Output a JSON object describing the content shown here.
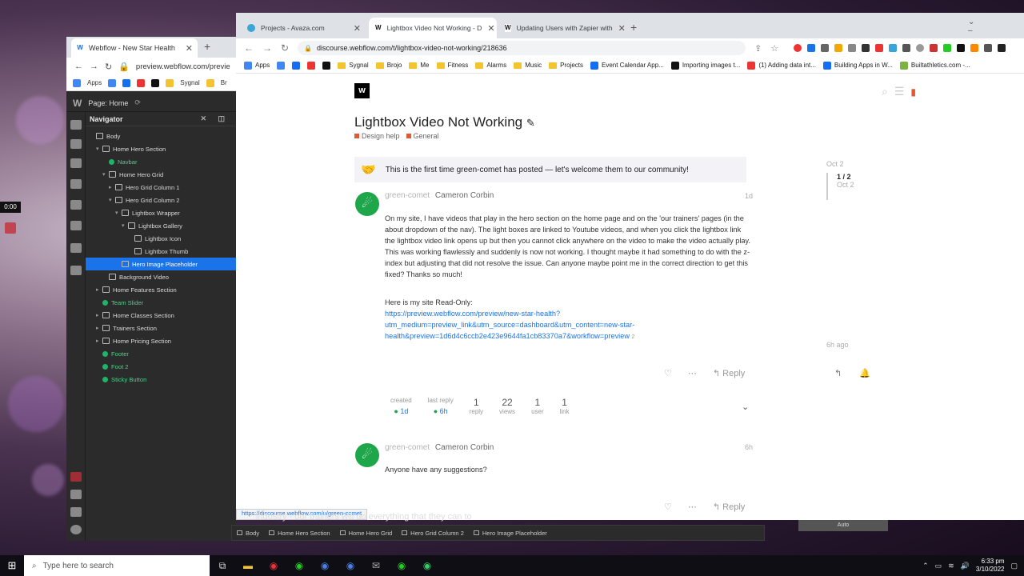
{
  "colors": {
    "webflow_blue": "#146ef5",
    "selection": "#1a73e8",
    "symbol_green": "#48d18a",
    "category_red": "#e45735"
  },
  "video": {
    "time": "0:00"
  },
  "webflow_window": {
    "tab_title": "Webflow - New Star Health",
    "url": "preview.webflow.com/previe",
    "bookmarks": [
      "Apps",
      "Sygnal",
      "Br"
    ],
    "page_label": "Page: Home",
    "navigator_title": "Navigator",
    "tree": [
      {
        "label": "Body",
        "indent": 0,
        "caret": "",
        "kind": "box"
      },
      {
        "label": "Home Hero Section",
        "indent": 1,
        "caret": "▾",
        "kind": "box"
      },
      {
        "label": "Navbar",
        "indent": 2,
        "caret": "",
        "kind": "symbol"
      },
      {
        "label": "Home Hero Grid",
        "indent": 2,
        "caret": "▾",
        "kind": "grid"
      },
      {
        "label": "Hero Grid Column 1",
        "indent": 3,
        "caret": "▸",
        "kind": "box"
      },
      {
        "label": "Hero Grid Column 2",
        "indent": 3,
        "caret": "▾",
        "kind": "box"
      },
      {
        "label": "Lightbox Wrapper",
        "indent": 4,
        "caret": "▾",
        "kind": "box"
      },
      {
        "label": "Lightbox Gallery",
        "indent": 5,
        "caret": "▾",
        "kind": "box"
      },
      {
        "label": "Lightbox Icon",
        "indent": 6,
        "caret": "",
        "kind": "img"
      },
      {
        "label": "Lightbox Thumb",
        "indent": 6,
        "caret": "",
        "kind": "img"
      },
      {
        "label": "Hero Image Placeholder",
        "indent": 4,
        "caret": "",
        "kind": "img",
        "selected": true
      },
      {
        "label": "Background Video",
        "indent": 2,
        "caret": "",
        "kind": "box"
      },
      {
        "label": "Home Features Section",
        "indent": 1,
        "caret": "▸",
        "kind": "box"
      },
      {
        "label": "Team Slider",
        "indent": 1,
        "caret": "",
        "kind": "symbol"
      },
      {
        "label": "Home Classes Section",
        "indent": 1,
        "caret": "▸",
        "kind": "box"
      },
      {
        "label": "Trainers Section",
        "indent": 1,
        "caret": "▸",
        "kind": "box"
      },
      {
        "label": "Home Pricing Section",
        "indent": 1,
        "caret": "▸",
        "kind": "box"
      },
      {
        "label": "Footer",
        "indent": 1,
        "caret": "",
        "kind": "symbol"
      },
      {
        "label": "Foot 2",
        "indent": 1,
        "caret": "",
        "kind": "symbol"
      },
      {
        "label": "Sticky Button",
        "indent": 1,
        "caret": "",
        "kind": "symbol"
      }
    ],
    "breadcrumbs": [
      "Body",
      "Home Hero Section",
      "Home Hero Grid",
      "Hero Grid Column 2",
      "Hero Image Placeholder"
    ],
    "auto_label": "Auto"
  },
  "chrome": {
    "tabs": [
      {
        "title": "Projects - Avaza.com",
        "active": false
      },
      {
        "title": "Lightbox Video Not Working - D",
        "active": true
      },
      {
        "title": "Updating Users with Zapier with",
        "active": false
      }
    ],
    "url": "discourse.webflow.com/t/lightbox-video-not-working/218636",
    "bookmarks": [
      "Apps",
      "Sygnal",
      "Brojo",
      "Me",
      "Fitness",
      "Alarms",
      "Music",
      "Projects",
      "Event Calendar App...",
      "Importing images t...",
      "(1) Adding data int...",
      "Building Apps in W...",
      "Builtathletics.com -..."
    ],
    "status_url": "https://discourse.webflow.com/u/green-comet"
  },
  "topic": {
    "logo": "w",
    "title": "Lightbox Video Not Working",
    "categories": [
      "Design help",
      "General"
    ],
    "first_post_notice": "This is the first time green-comet has posted — let's welcome them to our community!",
    "post1": {
      "username": "green-comet",
      "fullname": "Cameron Corbin",
      "time": "1d",
      "body": "On my site, I have videos that play in the hero section on the home page and on the 'our trainers' pages (in the about dropdown of the nav). The light boxes are linked to Youtube videos, and when you click the lightbox link the lightbox video link opens up but then you cannot click anywhere on the video to make the video actually play. This was working flawlessly and suddenly is now not working. I thought maybe it had something to do with the z-index but adjusting that did not resolve the issue. Can anyone maybe point me in the correct direction to get this fixed? Thanks so much!",
      "readonly_intro": "Here is my site Read-Only:",
      "link_line1": "https://preview.webflow.com/preview/new-star-health?",
      "link_line2": "utm_medium=preview_link&utm_source=dashboard&utm_content=new-star-",
      "link_line3": "health&preview=1d6d4c6ccb2e423e9644fa1cb83370a7&workflow=preview",
      "link_clicks": "2",
      "reply_label": "Reply"
    },
    "summary": {
      "created_label": "created",
      "created_value": "1d",
      "last_reply_label": "last reply",
      "last_reply_value": "6h",
      "replies": "1",
      "replies_label": "reply",
      "views": "22",
      "views_label": "views",
      "users": "1",
      "users_label": "user",
      "links": "1",
      "links_label": "link"
    },
    "post2": {
      "username": "green-comet",
      "fullname": "Cameron Corbin",
      "time": "6h",
      "body": "Anyone have any suggestions?",
      "reply_label": "Reply"
    },
    "timeline": {
      "start": "Oct 2",
      "progress": "1 / 2",
      "progress_date": "Oct 2",
      "end": "6h ago"
    }
  },
  "caption": "industry - our trainers will do everything that they can to",
  "taskbar": {
    "search_placeholder": "Type here to search",
    "time": "6:33 pm",
    "date": "3/10/2022"
  }
}
